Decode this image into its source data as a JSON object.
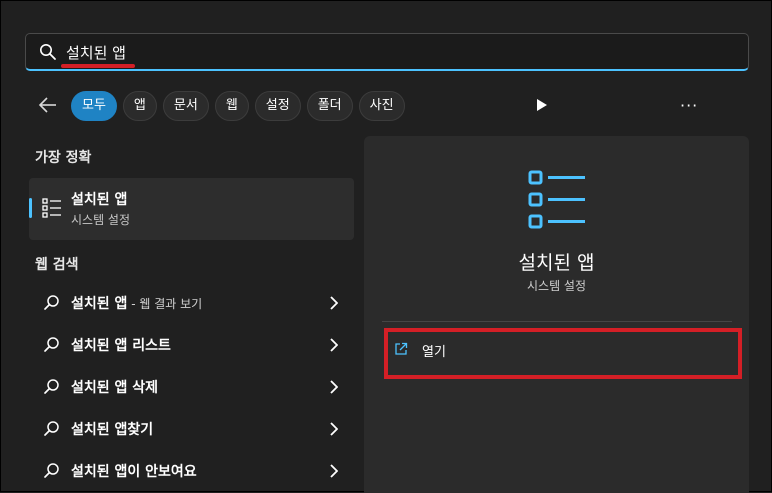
{
  "search": {
    "value": "설치된 앱",
    "icon": "search-icon"
  },
  "filters": {
    "back_icon": "back-arrow-icon",
    "chips": [
      {
        "label": "모두",
        "active": true
      },
      {
        "label": "앱",
        "active": false
      },
      {
        "label": "문서",
        "active": false
      },
      {
        "label": "웹",
        "active": false
      },
      {
        "label": "설정",
        "active": false
      },
      {
        "label": "폴더",
        "active": false
      },
      {
        "label": "사진",
        "active": false
      }
    ],
    "play_icon": "play-icon",
    "more_label": "···"
  },
  "best_match": {
    "section_title": "가장 정확",
    "title": "설치된 앱",
    "subtitle": "시스템 설정",
    "icon": "list-settings-icon"
  },
  "web_search": {
    "section_title": "웹 검색",
    "items": [
      {
        "text": "설치된 앱",
        "suffix": " - 웹 결과 보기"
      },
      {
        "text": "설치된 앱 리스트",
        "suffix": ""
      },
      {
        "text": "설치된 앱 삭제",
        "suffix": ""
      },
      {
        "text": "설치된 앱찾기",
        "suffix": ""
      },
      {
        "text": "설치된 앱이 안보여요",
        "suffix": ""
      }
    ]
  },
  "detail": {
    "title": "설치된 앱",
    "subtitle": "시스템 설정",
    "open_label": "열기",
    "open_icon": "open-external-icon"
  },
  "colors": {
    "accent": "#4cc2ff",
    "active_chip": "#1f83c4",
    "annotation_red": "#d41f26",
    "background": "#202020",
    "panel": "#2b2b2b"
  }
}
